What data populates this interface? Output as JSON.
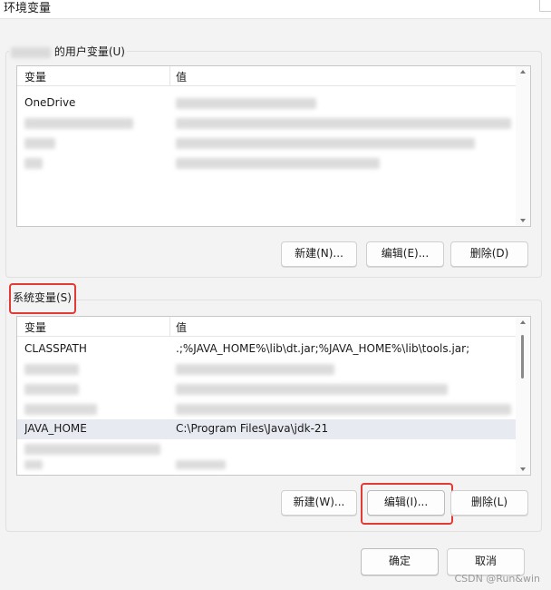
{
  "window": {
    "title": "环境变量"
  },
  "user_section": {
    "legend": "的用户变量(U)",
    "header": {
      "name": "变量",
      "value": "值"
    },
    "rows": [
      {
        "name": "OneDrive",
        "value": ""
      },
      {
        "name": "",
        "value": ""
      },
      {
        "name": "",
        "value": ""
      },
      {
        "name": "",
        "value": ""
      }
    ],
    "buttons": {
      "new": "新建(N)...",
      "edit": "编辑(E)...",
      "delete": "删除(D)"
    }
  },
  "system_section": {
    "legend": "系统变量(S)",
    "header": {
      "name": "变量",
      "value": "值"
    },
    "rows": [
      {
        "name": "CLASSPATH",
        "value": ".;%JAVA_HOME%\\lib\\dt.jar;%JAVA_HOME%\\lib\\tools.jar;"
      },
      {
        "name": "",
        "value": ""
      },
      {
        "name": "",
        "value": ""
      },
      {
        "name": "",
        "value": ""
      },
      {
        "name": "JAVA_HOME",
        "value": "C:\\Program Files\\Java\\jdk-21"
      },
      {
        "name": "",
        "value": ""
      },
      {
        "name": "",
        "value": ""
      }
    ],
    "buttons": {
      "new": "新建(W)...",
      "edit": "编辑(I)...",
      "delete": "删除(L)"
    }
  },
  "footer": {
    "ok": "确定",
    "cancel": "取消"
  },
  "watermark": "CSDN @Run&win",
  "colors": {
    "highlight": "#e23b35",
    "selected_row": "#e7eaf0"
  }
}
